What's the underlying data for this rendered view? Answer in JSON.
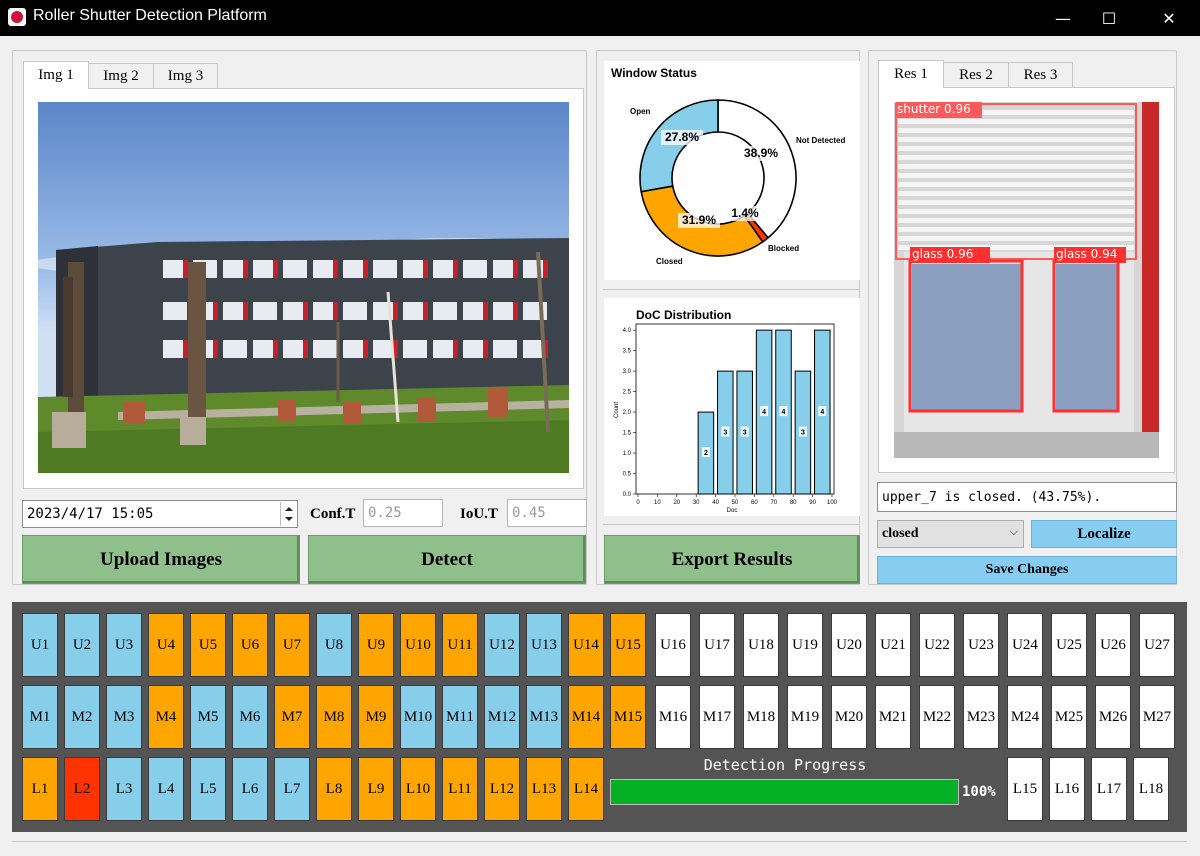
{
  "window": {
    "title": "Roller Shutter Detection Platform",
    "minimize": "—",
    "maximize": "☐",
    "close": "✕"
  },
  "input_tabs": [
    {
      "label": "Img 1",
      "active": true
    },
    {
      "label": "Img 2",
      "active": false
    },
    {
      "label": "Img 3",
      "active": false
    }
  ],
  "controls": {
    "datetime": "2023/4/17 15:05",
    "conf_label": "Conf.T",
    "conf_value": "0.25",
    "iou_label": "IoU.T",
    "iou_value": "0.45",
    "upload": "Upload Images",
    "detect": "Detect",
    "export": "Export Results"
  },
  "result_tabs": [
    {
      "label": "Res 1",
      "active": true
    },
    {
      "label": "Res 2",
      "active": false
    },
    {
      "label": "Res 3",
      "active": false
    }
  ],
  "detections": [
    {
      "label": "shutter  0.96"
    },
    {
      "label": "glass  0.96"
    },
    {
      "label": "glass  0.94"
    }
  ],
  "result": {
    "message": "upper_7 is closed. (43.75%).",
    "status_selected": "closed",
    "localize": "Localize",
    "save": "Save Changes"
  },
  "colors": {
    "open": "#87ceeb",
    "closed": "#ffa500",
    "blocked": "#ff3300",
    "not_detected": "#ffffff",
    "progress": "#06b025",
    "grid_bg": "#545454"
  },
  "chart_data": [
    {
      "type": "pie",
      "title": "Window Status",
      "labels": [
        "Not Detected",
        "Blocked",
        "Closed",
        "Open"
      ],
      "values": [
        38.9,
        1.4,
        31.9,
        27.8
      ],
      "display": [
        "38.9%",
        "1.4%",
        "31.9%",
        "27.8%"
      ],
      "colors": [
        "#ffffff",
        "#ff3300",
        "#ffa500",
        "#87ceeb"
      ],
      "donut": true
    },
    {
      "type": "bar",
      "title": "DoC Distribution",
      "xlabel": "Doc",
      "ylabel": "Count",
      "categories": [
        0,
        10,
        20,
        30,
        40,
        50,
        60,
        70,
        80,
        90,
        100
      ],
      "bars": [
        {
          "x": 35,
          "value": 2
        },
        {
          "x": 45,
          "value": 3
        },
        {
          "x": 55,
          "value": 3
        },
        {
          "x": 65,
          "value": 4
        },
        {
          "x": 75,
          "value": 4
        },
        {
          "x": 85,
          "value": 3
        },
        {
          "x": 95,
          "value": 4
        }
      ],
      "yticks": [
        "0.0",
        "0.5",
        "1.0",
        "1.5",
        "2.0",
        "2.5",
        "3.0",
        "3.5",
        "4.0"
      ],
      "xlim": [
        0,
        100
      ],
      "ylim": [
        0,
        4.15
      ]
    }
  ],
  "grid": {
    "upper": [
      {
        "label": "U1",
        "state": "open"
      },
      {
        "label": "U2",
        "state": "open"
      },
      {
        "label": "U3",
        "state": "open"
      },
      {
        "label": "U4",
        "state": "closed"
      },
      {
        "label": "U5",
        "state": "closed"
      },
      {
        "label": "U6",
        "state": "closed"
      },
      {
        "label": "U7",
        "state": "closed"
      },
      {
        "label": "U8",
        "state": "open"
      },
      {
        "label": "U9",
        "state": "closed"
      },
      {
        "label": "U10",
        "state": "closed"
      },
      {
        "label": "U11",
        "state": "closed"
      },
      {
        "label": "U12",
        "state": "open"
      },
      {
        "label": "U13",
        "state": "open"
      },
      {
        "label": "U14",
        "state": "closed"
      },
      {
        "label": "U15",
        "state": "closed"
      },
      {
        "label": "U16",
        "state": "nd"
      },
      {
        "label": "U17",
        "state": "nd"
      },
      {
        "label": "U18",
        "state": "nd"
      },
      {
        "label": "U19",
        "state": "nd"
      },
      {
        "label": "U20",
        "state": "nd"
      },
      {
        "label": "U21",
        "state": "nd"
      },
      {
        "label": "U22",
        "state": "nd"
      },
      {
        "label": "U23",
        "state": "nd"
      },
      {
        "label": "U24",
        "state": "nd"
      },
      {
        "label": "U25",
        "state": "nd"
      },
      {
        "label": "U26",
        "state": "nd"
      },
      {
        "label": "U27",
        "state": "nd"
      }
    ],
    "middle": [
      {
        "label": "M1",
        "state": "open"
      },
      {
        "label": "M2",
        "state": "open"
      },
      {
        "label": "M3",
        "state": "open"
      },
      {
        "label": "M4",
        "state": "closed"
      },
      {
        "label": "M5",
        "state": "open"
      },
      {
        "label": "M6",
        "state": "open"
      },
      {
        "label": "M7",
        "state": "closed"
      },
      {
        "label": "M8",
        "state": "closed"
      },
      {
        "label": "M9",
        "state": "closed"
      },
      {
        "label": "M10",
        "state": "open"
      },
      {
        "label": "M11",
        "state": "open"
      },
      {
        "label": "M12",
        "state": "open"
      },
      {
        "label": "M13",
        "state": "open"
      },
      {
        "label": "M14",
        "state": "closed"
      },
      {
        "label": "M15",
        "state": "closed"
      },
      {
        "label": "M16",
        "state": "nd"
      },
      {
        "label": "M17",
        "state": "nd"
      },
      {
        "label": "M18",
        "state": "nd"
      },
      {
        "label": "M19",
        "state": "nd"
      },
      {
        "label": "M20",
        "state": "nd"
      },
      {
        "label": "M21",
        "state": "nd"
      },
      {
        "label": "M22",
        "state": "nd"
      },
      {
        "label": "M23",
        "state": "nd"
      },
      {
        "label": "M24",
        "state": "nd"
      },
      {
        "label": "M25",
        "state": "nd"
      },
      {
        "label": "M26",
        "state": "nd"
      },
      {
        "label": "M27",
        "state": "nd"
      }
    ],
    "lower_left": [
      {
        "label": "L1",
        "state": "closed"
      },
      {
        "label": "L2",
        "state": "blocked"
      },
      {
        "label": "L3",
        "state": "open"
      },
      {
        "label": "L4",
        "state": "open"
      },
      {
        "label": "L5",
        "state": "open"
      },
      {
        "label": "L6",
        "state": "open"
      },
      {
        "label": "L7",
        "state": "open"
      },
      {
        "label": "L8",
        "state": "closed"
      },
      {
        "label": "L9",
        "state": "closed"
      },
      {
        "label": "L10",
        "state": "closed"
      },
      {
        "label": "L11",
        "state": "closed"
      },
      {
        "label": "L12",
        "state": "closed"
      },
      {
        "label": "L13",
        "state": "closed"
      },
      {
        "label": "L14",
        "state": "closed"
      }
    ],
    "lower_right": [
      {
        "label": "L15",
        "state": "nd"
      },
      {
        "label": "L16",
        "state": "nd"
      },
      {
        "label": "L17",
        "state": "nd"
      },
      {
        "label": "L18",
        "state": "nd"
      }
    ]
  },
  "progress": {
    "label": "Detection Progress",
    "value": 100,
    "text": "100%"
  }
}
